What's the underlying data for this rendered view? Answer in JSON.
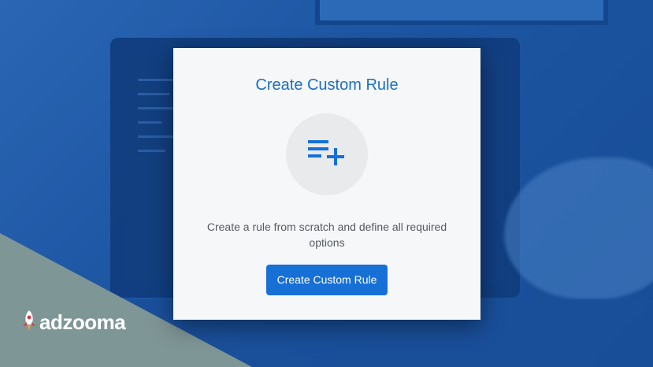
{
  "card": {
    "title": "Create Custom Rule",
    "icon": "playlist-add-icon",
    "description": "Create a rule from scratch and define all required options",
    "button_label": "Create Custom Rule"
  },
  "brand": {
    "logo_text": "adzooma",
    "logo_icon": "rocket-icon"
  },
  "colors": {
    "accent": "#1670d6",
    "title": "#1a6fc4",
    "background": "#1f5aa8",
    "corner": "#7f9696"
  }
}
